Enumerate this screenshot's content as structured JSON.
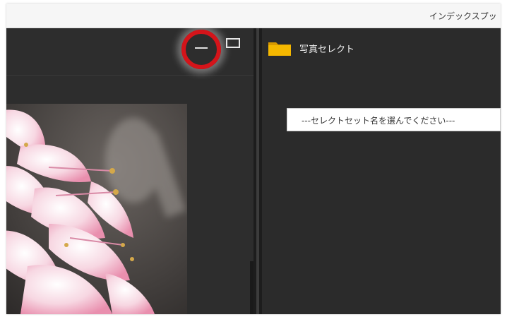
{
  "window": {
    "title": "インデックスプッ"
  },
  "left_panel": {
    "minimize_icon": "minimize-icon",
    "maximize_icon": "maximize-icon",
    "highlight_color": "#d4141a"
  },
  "right_panel": {
    "folder_icon": "folder-icon",
    "label": "写真セレクト",
    "select_set": {
      "value": "---セレクトセット名を選んでください---"
    }
  },
  "colors": {
    "panel_bg": "#2b2b2b",
    "folder": "#f5b800",
    "accent_ring": "#d4141a"
  }
}
